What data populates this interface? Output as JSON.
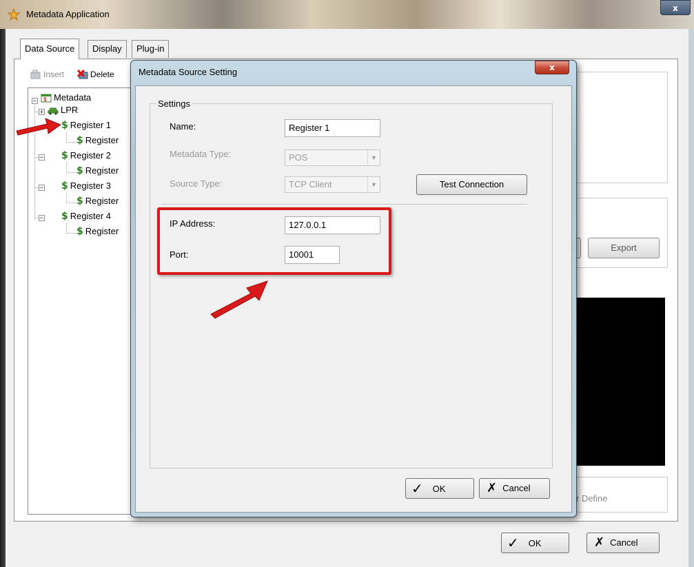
{
  "window": {
    "title": "Metadata Application",
    "close": "x"
  },
  "tabs": [
    {
      "label": "Data Source"
    },
    {
      "label": "Display"
    },
    {
      "label": "Plug-in"
    }
  ],
  "toolbar": {
    "insert_label": "Insert",
    "delete_label": "Delete"
  },
  "tree": {
    "root": "Metadata",
    "items": [
      "LPR",
      "Register 1",
      "Register",
      "Register 2",
      "Register",
      "Register 3",
      "Register",
      "Register 4",
      "Register"
    ]
  },
  "background_panel": {
    "export_label": "Export",
    "user_define_label": "r Define"
  },
  "footer": {
    "ok_label": "OK",
    "cancel_label": "Cancel"
  },
  "dialog": {
    "title": "Metadata Source Setting",
    "close": "x",
    "group_label": "Settings",
    "fields": {
      "name_label": "Name:",
      "name_value": "Register 1",
      "metadata_type_label": "Metadata Type:",
      "metadata_type_value": "POS",
      "source_type_label": "Source Type:",
      "source_type_value": "TCP Client",
      "test_connection_label": "Test Connection",
      "ip_label": "IP Address:",
      "ip_value": "127.0.0.1",
      "port_label": "Port:",
      "port_value": "10001"
    },
    "ok_label": "OK",
    "cancel_label": "Cancel"
  },
  "colors": {
    "annotation_red": "#d81a1a",
    "tree_icon_green": "#2e7d1e"
  },
  "icons": [
    "app-icon",
    "insert-icon",
    "delete-icon",
    "database-icon",
    "car-icon",
    "dollar-register-icon",
    "checkmark-icon",
    "x-icon"
  ]
}
